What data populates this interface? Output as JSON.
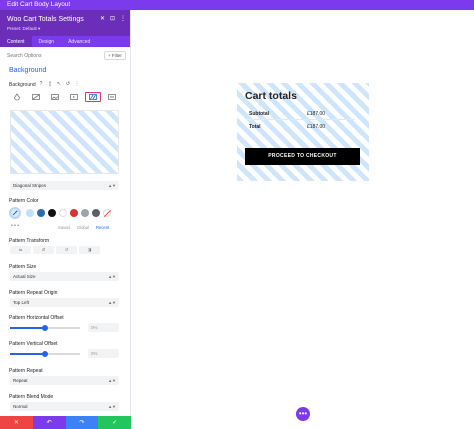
{
  "window": {
    "title": "Edit Cart Body Layout"
  },
  "panel": {
    "title": "Woo Cart Totals Settings",
    "preset": "Preset: Default ▾",
    "header_icons": [
      "✕",
      "⊡",
      "⋮"
    ],
    "tabs": [
      {
        "label": "Content",
        "active": true
      },
      {
        "label": "Design",
        "active": false
      },
      {
        "label": "Advanced",
        "active": false
      }
    ],
    "search_placeholder": "Search Options",
    "filter_label": "+ Filter",
    "section_title": "Background",
    "section_controls": "▲ ⋮",
    "background_label": "Background",
    "background_icons": [
      "?",
      "▯",
      "↖",
      "↺",
      "⋮"
    ],
    "pattern_style": "Diagonal Stripes",
    "pattern_color_label": "Pattern Color",
    "swatch_colors": [
      "#bfe0fb",
      "#2b6cb0",
      "#111111",
      "#ffffff",
      "#d93030",
      "#9ca3af",
      "#5b5f66"
    ],
    "palette_tabs": [
      "Saved",
      "Global",
      "Recent"
    ],
    "pattern_transform_label": "Pattern Transform",
    "pattern_size_label": "Pattern Size",
    "pattern_size_value": "Actual Size",
    "repeat_origin_label": "Pattern Repeat Origin",
    "repeat_origin_value": "Top Left",
    "h_offset_label": "Pattern Horizontal Offset",
    "h_offset_value": "0%",
    "v_offset_label": "Pattern Vertical Offset",
    "v_offset_value": "0%",
    "pattern_repeat_label": "Pattern Repeat",
    "pattern_repeat_value": "Repeat",
    "blend_mode_label": "Pattern Blend Mode",
    "blend_mode_value": "Normal",
    "bottom_buttons": [
      {
        "icon": "✕",
        "color": "#ef4444"
      },
      {
        "icon": "↶",
        "color": "#7c3aed"
      },
      {
        "icon": "↷",
        "color": "#3b82f6"
      },
      {
        "icon": "✓",
        "color": "#22c55e"
      }
    ]
  },
  "preview": {
    "title": "Cart totals",
    "subtotal_label": "Subtotal",
    "subtotal_value": "£187.00",
    "total_label": "Total",
    "total_value": "£187.00",
    "checkout_label": "PROCEED TO CHECKOUT",
    "fab_icon": "•••"
  },
  "colors": {
    "accent": "#7c3aed",
    "stripe": "#cfe5fb",
    "active_blue": "#2563eb",
    "highlight": "#e0337a"
  }
}
